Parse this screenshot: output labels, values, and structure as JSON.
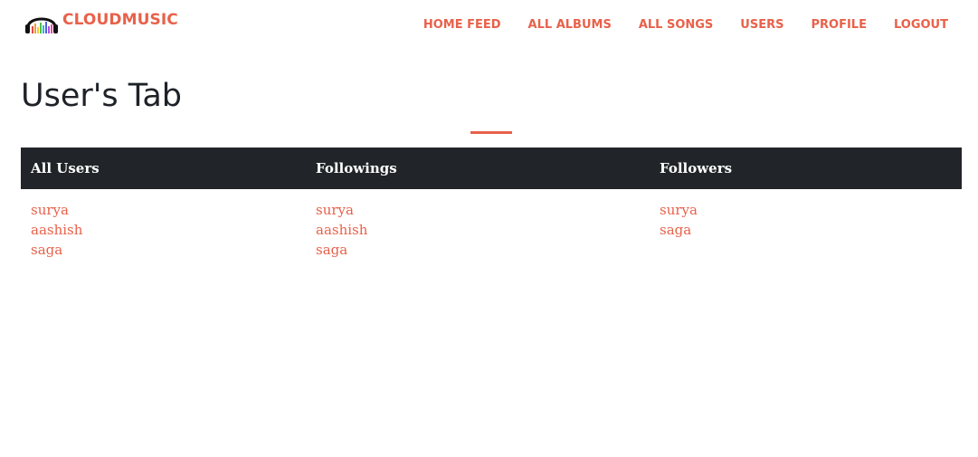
{
  "brand": {
    "name": "CLOUDMUSIC",
    "logo_icon": "headphones-equalizer-icon"
  },
  "nav": {
    "links": [
      "HOME FEED",
      "ALL ALBUMS",
      "ALL SONGS",
      "USERS",
      "PROFILE",
      "LOGOUT"
    ]
  },
  "page": {
    "title": "User's Tab"
  },
  "table": {
    "headers": [
      "All Users",
      "Followings",
      "Followers"
    ],
    "all_users": [
      "surya",
      "aashish",
      "saga"
    ],
    "followings": [
      "surya",
      "aashish",
      "saga"
    ],
    "followers": [
      "surya",
      "saga"
    ]
  },
  "colors": {
    "accent": "#e8614a",
    "header_bg": "#212529",
    "title_text": "#1e2228"
  }
}
